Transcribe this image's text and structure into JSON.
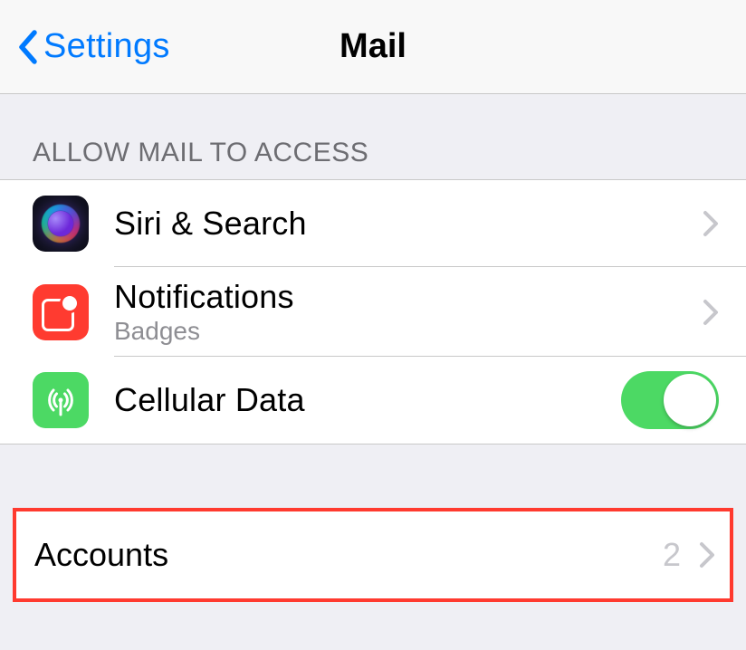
{
  "navbar": {
    "back_label": "Settings",
    "title": "Mail"
  },
  "section1": {
    "header": "Allow Mail to Access",
    "rows": {
      "siri": {
        "label": "Siri & Search"
      },
      "notifications": {
        "label": "Notifications",
        "sublabel": "Badges"
      },
      "cellular": {
        "label": "Cellular Data",
        "toggle_on": true
      }
    }
  },
  "section2": {
    "accounts": {
      "label": "Accounts",
      "count": "2"
    }
  }
}
